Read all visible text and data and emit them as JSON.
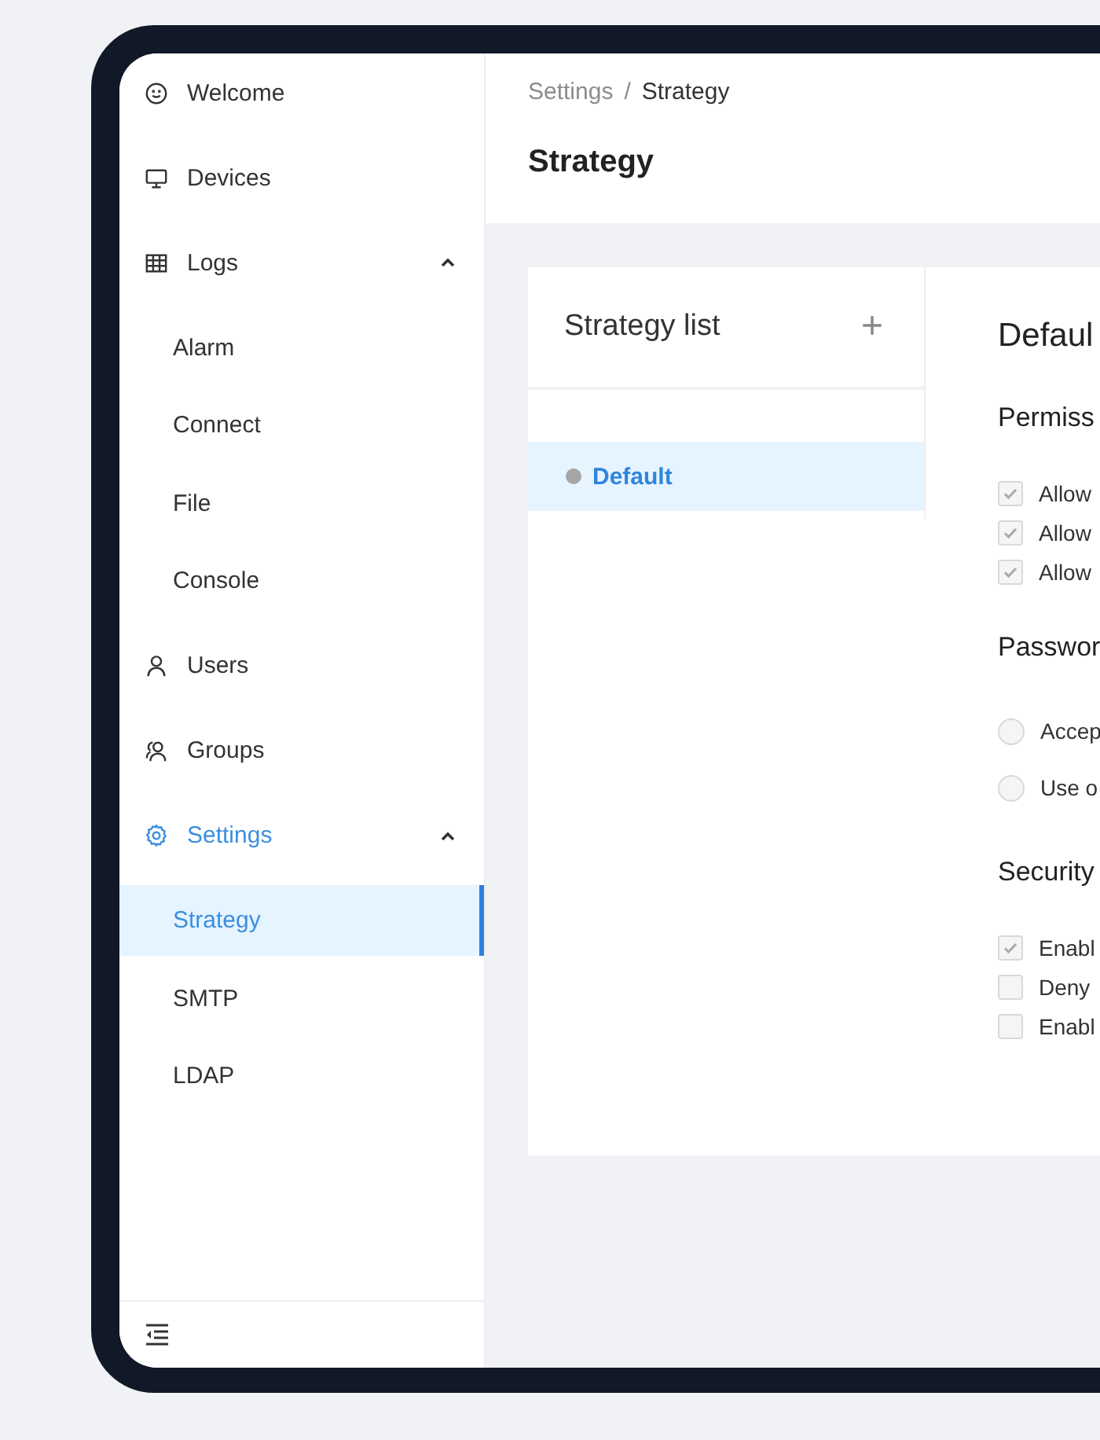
{
  "sidebar": {
    "items": [
      {
        "label": "Welcome",
        "selected": false
      },
      {
        "label": "Devices",
        "selected": false
      },
      {
        "label": "Logs",
        "expanded": true,
        "children": [
          {
            "label": "Alarm",
            "selected": false
          },
          {
            "label": "Connect",
            "selected": false
          },
          {
            "label": "File",
            "selected": false
          },
          {
            "label": "Console",
            "selected": false
          }
        ]
      },
      {
        "label": "Users",
        "selected": false
      },
      {
        "label": "Groups",
        "selected": false
      },
      {
        "label": "Settings",
        "expanded": true,
        "children": [
          {
            "label": "Strategy",
            "selected": true
          },
          {
            "label": "SMTP",
            "selected": false
          },
          {
            "label": "LDAP",
            "selected": false
          }
        ]
      }
    ]
  },
  "breadcrumb": {
    "items": [
      "Settings",
      "Strategy"
    ],
    "separator": "/"
  },
  "page_title": "Strategy",
  "strategy_list": {
    "title": "Strategy list",
    "add_button": "+",
    "items": [
      {
        "name": "Default",
        "selected": true
      }
    ]
  },
  "detail": {
    "title": "Defaul",
    "sections": [
      {
        "title": "Permiss",
        "options": [
          {
            "kind": "checkbox",
            "label": "Allow",
            "checked": true
          },
          {
            "kind": "checkbox",
            "label": "Allow",
            "checked": true
          },
          {
            "kind": "checkbox",
            "label": "Allow",
            "checked": true
          }
        ]
      },
      {
        "title": "Passwor",
        "options": [
          {
            "kind": "radio",
            "label": "Accep",
            "selected": false
          },
          {
            "kind": "radio",
            "label": "Use o",
            "selected": false
          }
        ]
      },
      {
        "title": "Security",
        "options": [
          {
            "kind": "checkbox",
            "label": "Enabl",
            "checked": true
          },
          {
            "kind": "checkbox",
            "label": "Deny",
            "checked": false
          },
          {
            "kind": "checkbox",
            "label": "Enabl",
            "checked": false
          }
        ]
      }
    ]
  }
}
